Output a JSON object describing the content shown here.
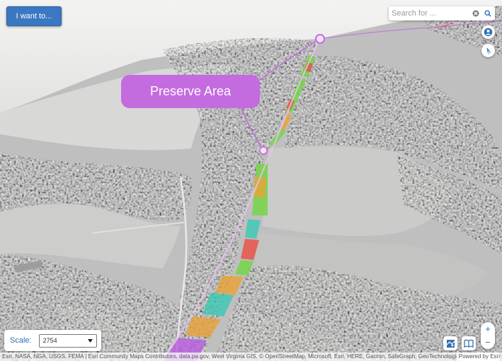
{
  "toolbar": {
    "i_want_to_label": "I want to..."
  },
  "search": {
    "placeholder": "Search for ...",
    "clear_icon": "clear-icon",
    "search_icon": "search-icon"
  },
  "map": {
    "callout_label": "Preserve Area",
    "route_colors": [
      "#b95ee0",
      "#73d643",
      "#e85045",
      "#3dc8b4",
      "#e8a238"
    ]
  },
  "scale": {
    "label": "Scale:",
    "value": "2754"
  },
  "zoom": {
    "in": "+",
    "out": "−"
  },
  "attribution": {
    "sources": "Esri, NASA, NGA, USGS, FEMA | Esri Community Maps Contributors, data.pa.gov, West Virginia GIS, © OpenStreetMap, Microsoft, Esri, HERE, Garmin, SafeGraph, GeoTechnologies, Inc,",
    "powered_by": "Powered by Esri"
  }
}
